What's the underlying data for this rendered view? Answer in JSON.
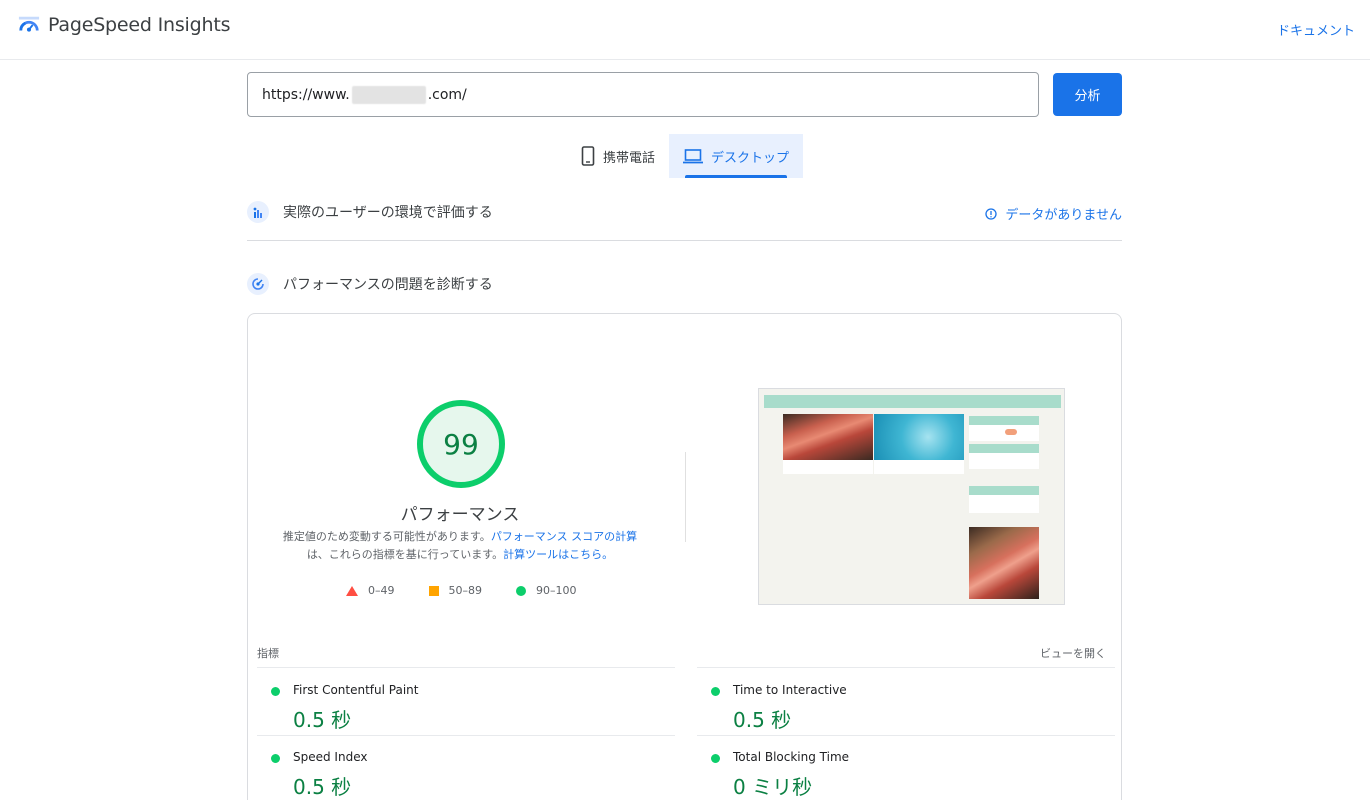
{
  "header": {
    "app_name": "PageSpeed Insights",
    "docs_label": "ドキュメント"
  },
  "search": {
    "url_prefix": "https://www.",
    "url_suffix": ".com/",
    "analyze_label": "分析"
  },
  "tabs": [
    {
      "label": "携帯電話",
      "icon": "phone-icon",
      "active": false
    },
    {
      "label": "デスクトップ",
      "icon": "laptop-icon",
      "active": true
    }
  ],
  "field_data": {
    "title": "実際のユーザーの環境で評価する",
    "status": "データがありません"
  },
  "lab_data": {
    "title": "パフォーマンスの問題を診断する"
  },
  "performance": {
    "score": "99",
    "label": "パフォーマンス",
    "note_prefix": "推定値のため変動する可能性があります。",
    "note_link1": "パフォーマンス スコアの計算",
    "note_middle": "は、これらの指標を基に行っています。",
    "note_link2": "計算ツールはこちら。",
    "legend": [
      {
        "range": "0–49",
        "shape": "triangle",
        "color": "#ff4e42"
      },
      {
        "range": "50–89",
        "shape": "square",
        "color": "#ffa400"
      },
      {
        "range": "90–100",
        "shape": "circle",
        "color": "#0cce6b"
      }
    ]
  },
  "metrics": {
    "title": "指標",
    "expand_label": "ビューを開く",
    "items": [
      {
        "name": "First Contentful Paint",
        "value": "0.5 秒"
      },
      {
        "name": "Time to Interactive",
        "value": "0.5 秒"
      },
      {
        "name": "Speed Index",
        "value": "0.5 秒"
      },
      {
        "name": "Total Blocking Time",
        "value": "0 ミリ秒"
      }
    ]
  },
  "colors": {
    "accent": "#1a73e8",
    "good": "#0cce6b",
    "good_text": "#0b8043"
  }
}
